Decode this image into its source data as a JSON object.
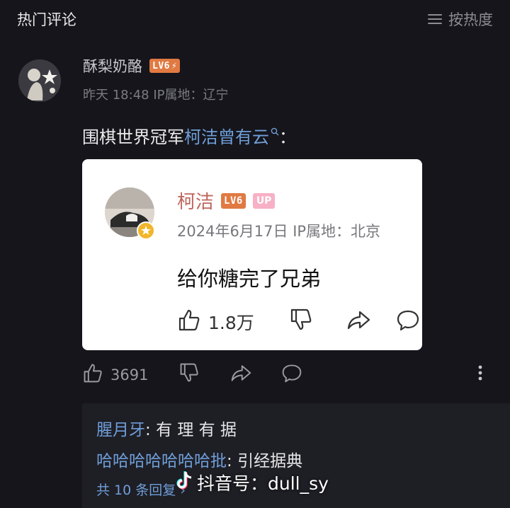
{
  "header": {
    "title": "热门评论",
    "sort_label": "按热度",
    "sort_icon": "list-icon"
  },
  "comment": {
    "username": "酥梨奶酪",
    "level_badge": "LV6",
    "meta": "昨天 18:48 IP属地：辽宁",
    "text_prefix": "围棋世界冠军",
    "text_link": "柯洁曾有云",
    "text_suffix": "：",
    "likes": "3691"
  },
  "quoted": {
    "username": "柯洁",
    "level_badge": "LV6",
    "up_badge": "UP",
    "meta": "2024年6月17日 IP属地：北京",
    "text": "给你糖完了兄弟",
    "likes": "1.8万"
  },
  "replies": [
    {
      "user": "腥月牙",
      "text": "有 理 有 据"
    },
    {
      "user": "哈哈哈哈哈哈哈批",
      "text": "引经据典"
    }
  ],
  "more_replies": "共 10 条回复",
  "watermark": {
    "label": "抖音号：dull_sy"
  },
  "colors": {
    "background": "#15151b",
    "link": "#6f9ed8",
    "level_badge": "#e07a42",
    "up_badge": "#f7b0c6",
    "card_name": "#c0655c"
  }
}
